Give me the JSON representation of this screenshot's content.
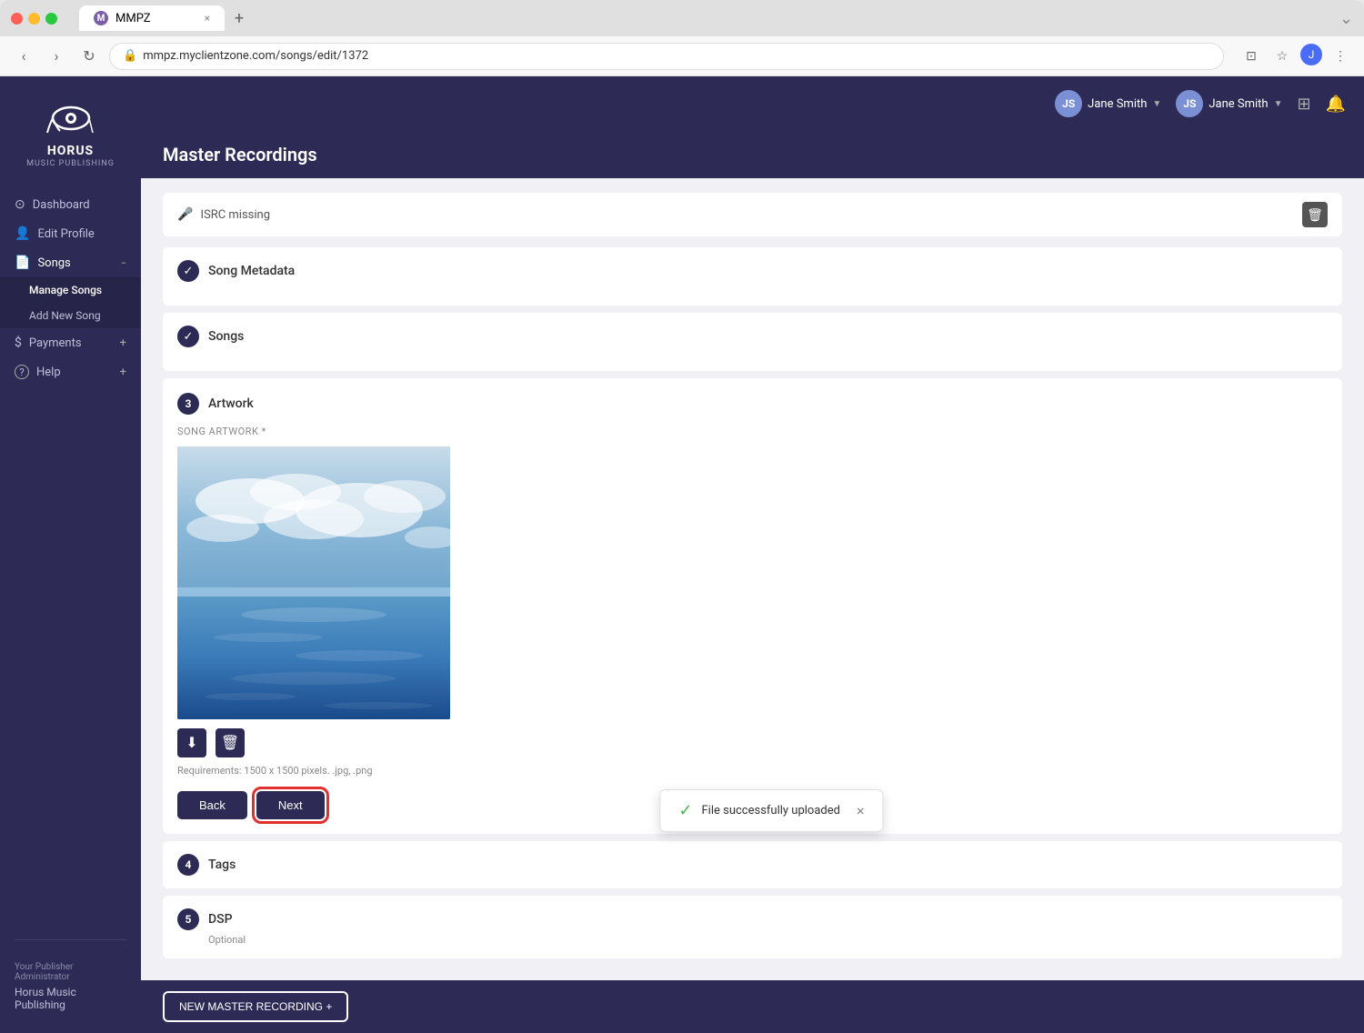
{
  "browser": {
    "url": "mmpz.myclientzone.com/songs/edit/1372",
    "tab_title": "MMPZ",
    "tab_favicon": "M"
  },
  "header": {
    "user1_name": "Jane Smith",
    "user2_name": "Jane Smith",
    "grid_icon": "⊞",
    "bell_icon": "🔔"
  },
  "sidebar": {
    "logo_text": "HORUS",
    "logo_subtitle": "MUSIC PUBLISHING",
    "nav_items": [
      {
        "id": "dashboard",
        "label": "Dashboard",
        "icon": "⊙"
      },
      {
        "id": "edit-profile",
        "label": "Edit Profile",
        "icon": "👤"
      },
      {
        "id": "songs",
        "label": "Songs",
        "icon": "📄",
        "has_toggle": true
      }
    ],
    "sub_items": [
      {
        "id": "manage-songs",
        "label": "Manage Songs",
        "active": true
      },
      {
        "id": "add-new-song",
        "label": "Add New Song"
      }
    ],
    "payments": {
      "label": "Payments",
      "icon": "💰"
    },
    "help": {
      "label": "Help",
      "icon": "?"
    },
    "publisher_label": "Your Publisher Administrator",
    "publisher_name": "Horus Music Publishing"
  },
  "page": {
    "title": "Master Recordings",
    "isrc_text": "ISRC missing",
    "steps": [
      {
        "id": "song-metadata",
        "label": "Song Metadata",
        "status": "complete",
        "number": "✓"
      },
      {
        "id": "songs",
        "label": "Songs",
        "status": "complete",
        "number": "✓"
      },
      {
        "id": "artwork",
        "label": "Artwork",
        "status": "active",
        "number": "3"
      },
      {
        "id": "tags",
        "label": "Tags",
        "status": "inactive",
        "number": "4"
      },
      {
        "id": "dsp",
        "label": "DSP",
        "status": "inactive",
        "number": "5"
      }
    ],
    "artwork": {
      "label": "SONG ARTWORK *",
      "requirements": "Requirements: 1500 x 1500 pixels. .jpg, .png"
    },
    "buttons": {
      "back": "Back",
      "next": "Next"
    },
    "dsp_optional": "Optional",
    "new_recording_btn": "NEW MASTER RECORDING +",
    "toast": {
      "message": "File successfully uploaded",
      "check_icon": "✓",
      "close_icon": "×"
    }
  }
}
